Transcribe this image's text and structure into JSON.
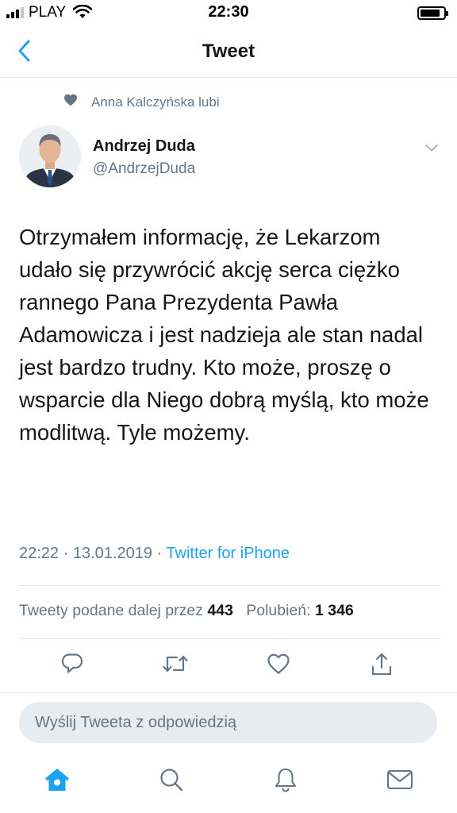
{
  "status_bar": {
    "carrier": "PLAY",
    "time": "22:30",
    "battery_level": 0.85,
    "signal_bars_active": 3,
    "signal_bars_total": 4
  },
  "nav": {
    "title": "Tweet",
    "back_icon": "chevron-left-icon"
  },
  "social_context": {
    "icon": "heart-filled-icon",
    "text": "Anna Kalczyńska lubi"
  },
  "author": {
    "name": "Andrzej Duda",
    "handle": "@AndrzejDuda"
  },
  "tweet": {
    "text": "Otrzymałem informację, że Lekarzom udało się przywrócić akcję serca ciężko rannego Pana Prezydenta Pawła Adamowicza i jest nadzieja ale stan nadal jest bardzo trudny. Kto może, proszę o wsparcie dla Niego dobrą myślą, kto może modlitwą. Tyle możemy.",
    "time": "22:22",
    "date": "13.01.2019",
    "separator": "·",
    "source": "Twitter for iPhone"
  },
  "stats": {
    "retweets_label": "Tweety podane dalej przez",
    "retweets_count": "443",
    "likes_label": "Polubień:",
    "likes_count": "1 346"
  },
  "actions": [
    "reply-icon",
    "retweet-icon",
    "like-icon",
    "share-icon"
  ],
  "reply": {
    "placeholder": "Wyślij Tweeta z odpowiedzią"
  },
  "tab_bar": {
    "active": "home",
    "items": [
      "home-icon",
      "search-icon",
      "notifications-icon",
      "messages-icon"
    ]
  },
  "colors": {
    "accent": "#1da1f2",
    "text_primary": "#14171a",
    "text_secondary": "#657786",
    "divider": "#e1e8ed",
    "input_bg": "#e6ecf0"
  }
}
